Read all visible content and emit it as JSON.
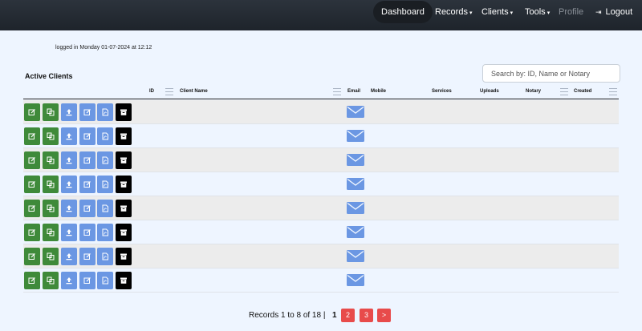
{
  "nav": {
    "dashboard": "Dashboard",
    "records": "Records",
    "clients": "Clients",
    "tools": "Tools",
    "profile": "Profile",
    "logout": "Logout",
    "caret": "▾",
    "logout_icon": "⇥"
  },
  "login_info": "logged in Monday 01-07-2024 at 12:12",
  "section_title": "Active Clients",
  "search": {
    "placeholder": "Search by: ID, Name or Notary",
    "value": ""
  },
  "table": {
    "columns": [
      "ID",
      "Client Name",
      "Email",
      "Mobile",
      "Services",
      "Uploads",
      "Notary",
      "Created"
    ],
    "row_count": 8,
    "row_actions": [
      "edit-icon",
      "copy-icon",
      "upload-icon",
      "edit-document-icon",
      "pdf-icon",
      "archive-icon"
    ],
    "email_icon": "envelope-icon"
  },
  "pagination": {
    "summary": "Records 1 to 8 of 18 |",
    "current": "1",
    "pages": [
      "2",
      "3"
    ],
    "next": ">"
  },
  "colors": {
    "navbar": "#2c333c",
    "green_button": "#3f8a3a",
    "blue_button": "#6b97e3",
    "page_button": "#e84b4b",
    "background": "#eef5ff"
  }
}
